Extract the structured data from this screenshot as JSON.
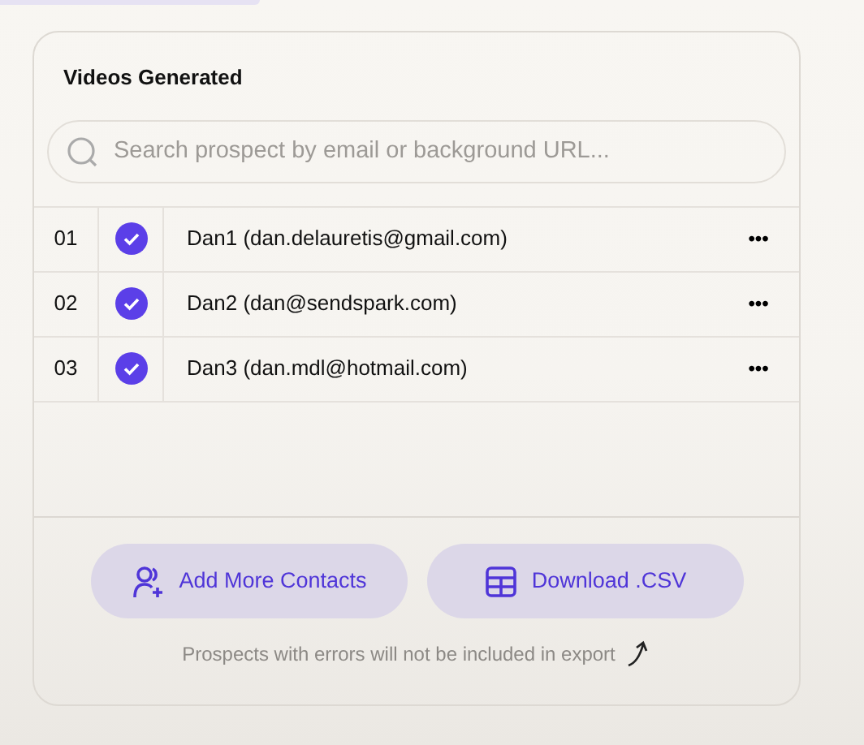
{
  "title": "Videos Generated",
  "search": {
    "placeholder": "Search prospect by email or background URL..."
  },
  "rows": [
    {
      "number": "01",
      "checked": true,
      "name": "Dan1 (dan.delauretis@gmail.com)",
      "menu": "•••"
    },
    {
      "number": "02",
      "checked": true,
      "name": "Dan2 (dan@sendspark.com)",
      "menu": "•••"
    },
    {
      "number": "03",
      "checked": true,
      "name": "Dan3 (dan.mdl@hotmail.com)",
      "menu": "•••"
    }
  ],
  "buttons": [
    {
      "kind": "add-contacts",
      "label": "Add More Contacts"
    },
    {
      "kind": "download",
      "label": "Download .CSV"
    }
  ],
  "note": "Prospects with errors will not be included in export"
}
